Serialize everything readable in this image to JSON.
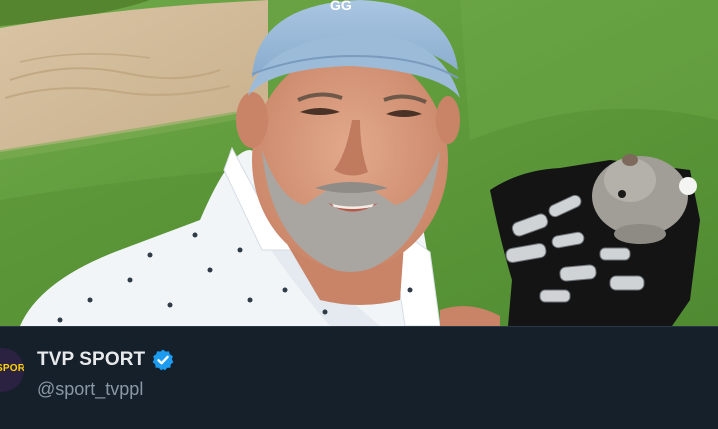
{
  "post": {
    "photo": {
      "icon": "golfer-selfie-photo"
    },
    "author": {
      "avatar_text": "SPORT",
      "display_name": "TVP SPORT",
      "handle": "@sport_tvppl",
      "verified_icon": "verified-badge-icon",
      "verified_color": "#1d9bf0"
    }
  },
  "colors": {
    "background": "#15202b",
    "name_text": "#e7e9ea",
    "handle_text": "#8b98a5",
    "avatar_accent": "#ffd400"
  }
}
